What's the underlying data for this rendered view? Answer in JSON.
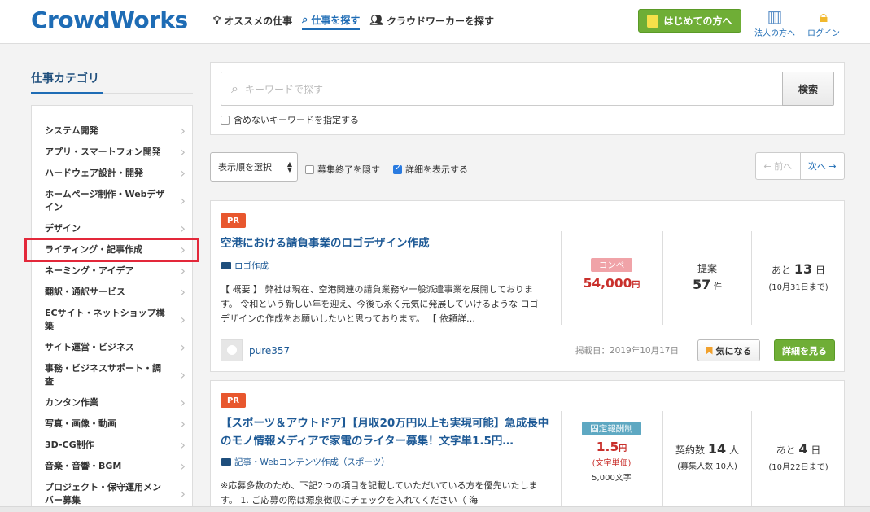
{
  "header": {
    "logo": "CrowdWorks",
    "nav": [
      {
        "label": "オススメの仕事",
        "icon": "lightbulb-icon"
      },
      {
        "label": "仕事を探す",
        "icon": "search-icon"
      },
      {
        "label": "クラウドワーカーを探す",
        "icon": "users-icon"
      }
    ],
    "start_button": "はじめての方へ",
    "corporate_link": "法人の方へ",
    "login_link": "ログイン"
  },
  "sidebar": {
    "title": "仕事カテゴリ",
    "categories": [
      "システム開発",
      "アプリ・スマートフォン開発",
      "ハードウェア設計・開発",
      "ホームページ制作・Webデザイン",
      "デザイン",
      "ライティング・記事作成",
      "ネーミング・アイデア",
      "翻訳・通訳サービス",
      "ECサイト・ネットショップ構築",
      "サイト運営・ビジネス",
      "事務・ビジネスサポート・調査",
      "カンタン作業",
      "写真・画像・動画",
      "3D-CG制作",
      "音楽・音響・BGM",
      "プロジェクト・保守運用メンバー募集"
    ]
  },
  "search": {
    "placeholder": "キーワードで探す",
    "button": "検索",
    "exclude_label": "含めないキーワードを指定する"
  },
  "toolbar": {
    "sort_label": "表示順を選択",
    "hide_closed": "募集終了を隠す",
    "show_detail": "詳細を表示する",
    "prev": "← 前へ",
    "next": "次へ →"
  },
  "jobs": [
    {
      "pr": "PR",
      "title": "空港における請負事業のロゴデザイン作成",
      "category": "ロゴ作成",
      "description": "【 概要 】 弊社は現在、空港関連の請負業務や一般派遣事業を展開しております。 令和という新しい年を迎え、今後も永く元気に発展していけるような ロゴデザインの作成をお願いしたいと思っております。 【 依頼詳…",
      "type_badge": "コンペ",
      "price": "54,000",
      "price_unit": "円",
      "mid_label": "提案",
      "mid_count": "57",
      "mid_unit": "件",
      "days_prefix": "あと",
      "days": "13",
      "days_unit": "日",
      "deadline": "(10月31日まで)",
      "user": "pure357",
      "posted": "掲載日：2019年10月17日",
      "fav_button": "気になる",
      "detail_button": "詳細を見る"
    },
    {
      "pr": "PR",
      "title": "【スポーツ＆アウトドア】【月収20万円以上も実現可能】急成長中のモノ情報メディアで家電のライター募集！文字単1.5円…",
      "category": "記事・Webコンテンツ作成（スポーツ）",
      "description": "※応募多数のため、下記2つの項目を記載していただいている方を優先いたします。 1. ご応募の際は源泉徴収にチェックを入れてください（ 海",
      "type_badge": "固定報酬制",
      "price": "1.5",
      "price_unit": "円",
      "price_note": "(文字単価)",
      "price_sub": "5,000文字",
      "mid_label": "契約数",
      "mid_count": "14",
      "mid_unit": "人",
      "mid_sub": "(募集人数 10人)",
      "days_prefix": "あと",
      "days": "4",
      "days_unit": "日",
      "deadline": "(10月22日まで)"
    }
  ],
  "colors": {
    "brand_blue": "#1e6cb5",
    "green": "#6fae36",
    "price_red": "#c9302c",
    "highlight_red": "#e3283a"
  }
}
